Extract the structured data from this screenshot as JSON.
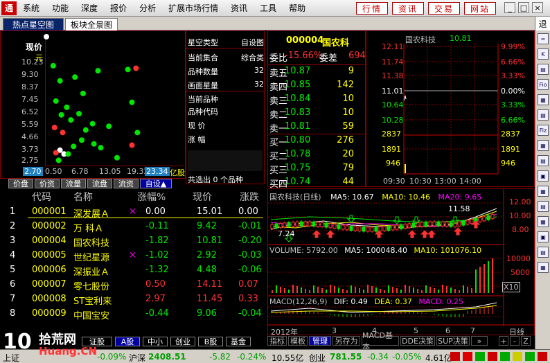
{
  "menu": {
    "logo": "通",
    "items": [
      "系统",
      "功能",
      "深度",
      "报价",
      "分析",
      "扩展市场行情",
      "资讯",
      "工具",
      "帮助"
    ],
    "quick_buttons": [
      "行情",
      "资讯",
      "交易",
      "网站"
    ],
    "win_buttons": [
      "_",
      "□",
      "×"
    ]
  },
  "tabs": [
    "热点星空图",
    "板块全景图"
  ],
  "back_label": "退",
  "right_toolbar": [
    "=",
    "K",
    "▤",
    "Fio",
    "▦",
    "▤",
    "Fiz",
    "▦",
    "▤",
    "▣",
    "▦",
    "▤",
    "▦",
    "▣",
    "▤",
    "▦"
  ],
  "scatter": {
    "y_title": "现价",
    "y_unit": "元",
    "y_labels": [
      "10.23",
      "9.30",
      "8.37",
      "7.45",
      "6.52",
      "5.59",
      "4.66",
      "3.73",
      "2.75"
    ],
    "x_labels": [
      "2.70",
      "0.50",
      "6.78",
      "13.05",
      "19.32",
      "23.34"
    ],
    "x_unit": "亿股",
    "colors": {
      "green": "#00e600",
      "red": "#ff3232",
      "white": "#ffffff"
    },
    "points": [
      {
        "c": "white",
        "x": 0.0,
        "y": 1.0
      },
      {
        "c": "white",
        "x": 0.1,
        "y": 0.1
      },
      {
        "c": "white",
        "x": 0.13,
        "y": 0.07
      },
      {
        "c": "green",
        "x": 0.05,
        "y": 0.77
      },
      {
        "c": "green",
        "x": 0.1,
        "y": 0.65
      },
      {
        "c": "green",
        "x": 0.21,
        "y": 0.68
      },
      {
        "c": "green",
        "x": 0.27,
        "y": 0.55
      },
      {
        "c": "green",
        "x": 0.38,
        "y": 0.73
      },
      {
        "c": "green",
        "x": 0.6,
        "y": 0.74
      },
      {
        "c": "green",
        "x": 0.07,
        "y": 0.49
      },
      {
        "c": "green",
        "x": 0.11,
        "y": 0.38
      },
      {
        "c": "green",
        "x": 0.15,
        "y": 0.44
      },
      {
        "c": "green",
        "x": 0.18,
        "y": 0.34
      },
      {
        "c": "green",
        "x": 0.24,
        "y": 0.39
      },
      {
        "c": "green",
        "x": 0.29,
        "y": 0.26
      },
      {
        "c": "green",
        "x": 0.34,
        "y": 0.31
      },
      {
        "c": "green",
        "x": 0.46,
        "y": 0.29
      },
      {
        "c": "green",
        "x": 0.26,
        "y": 0.18
      },
      {
        "c": "green",
        "x": 0.35,
        "y": 0.15
      },
      {
        "c": "green",
        "x": 0.4,
        "y": 0.12
      },
      {
        "c": "green",
        "x": 0.16,
        "y": 0.07
      },
      {
        "c": "green",
        "x": 0.09,
        "y": 0.02
      },
      {
        "c": "green",
        "x": 0.2,
        "y": 0.13
      },
      {
        "c": "green",
        "x": 0.52,
        "y": 0.04
      },
      {
        "c": "green",
        "x": 0.63,
        "y": 0.48
      },
      {
        "c": "green",
        "x": 0.67,
        "y": 0.24
      },
      {
        "c": "red",
        "x": 0.06,
        "y": 0.28
      },
      {
        "c": "red",
        "x": 0.12,
        "y": 0.24
      },
      {
        "c": "red",
        "x": 0.66,
        "y": 0.75
      },
      {
        "c": "red",
        "x": 0.63,
        "y": 0.14
      },
      {
        "c": "red",
        "x": 0.07,
        "y": 0.08
      }
    ]
  },
  "info": {
    "header_label": "星空类型",
    "header_value": "自设图",
    "rows": [
      {
        "label": "当前集合",
        "value": "综合类"
      },
      {
        "label": "品种数量",
        "value": "32"
      },
      {
        "label": "画面星量",
        "value": "32"
      },
      {
        "label": "当前品种",
        "value": ""
      },
      {
        "label": "品种代码",
        "value": ""
      },
      {
        "label": "现  价",
        "value": ""
      },
      {
        "label": "涨  幅",
        "value": ""
      }
    ],
    "footer": "共选出 0 个品种"
  },
  "sector_tabs": [
    "价盘",
    "价资",
    "流量",
    "流盘",
    "流资",
    "自设▲"
  ],
  "table": {
    "headers": [
      "代码",
      "名称",
      "涨幅%",
      "现价",
      "涨跌"
    ],
    "rows": [
      {
        "n": "1",
        "code": "000001",
        "name": "深发展Ａ",
        "mark": "×",
        "pct": "0.00",
        "price": "15.01",
        "chg": "0.00",
        "dir": "flat"
      },
      {
        "n": "2",
        "code": "000002",
        "name": "万  科Ａ",
        "mark": "",
        "pct": "-0.11",
        "price": "9.42",
        "chg": "-0.01",
        "dir": "down"
      },
      {
        "n": "3",
        "code": "000004",
        "name": "国农科技",
        "mark": "",
        "pct": "-1.82",
        "price": "10.81",
        "chg": "-0.20",
        "dir": "down"
      },
      {
        "n": "4",
        "code": "000005",
        "name": "世纪星源",
        "mark": "×",
        "pct": "-1.02",
        "price": "2.92",
        "chg": "-0.03",
        "dir": "down"
      },
      {
        "n": "5",
        "code": "000006",
        "name": "深振业Ａ",
        "mark": "",
        "pct": "-1.32",
        "price": "4.48",
        "chg": "-0.06",
        "dir": "down"
      },
      {
        "n": "6",
        "code": "000007",
        "name": "零七股份",
        "mark": "",
        "pct": "0.50",
        "price": "14.11",
        "chg": "0.07",
        "dir": "up"
      },
      {
        "n": "7",
        "code": "000008",
        "name": "ST宝利来",
        "mark": "",
        "pct": "2.97",
        "price": "11.45",
        "chg": "0.33",
        "dir": "up"
      },
      {
        "n": "8",
        "code": "000009",
        "name": "中国宝安",
        "mark": "",
        "pct": "-0.44",
        "price": "9.06",
        "chg": "-0.04",
        "dir": "down"
      }
    ]
  },
  "quote": {
    "code": "000004",
    "name": "国农科",
    "wei_bi_label": "委比",
    "wei_bi_value": "-15.66%",
    "wei_cha_label": "委差",
    "wei_cha_value": "694",
    "sells": [
      {
        "label": "卖五",
        "price": "10.87",
        "vol": "9"
      },
      {
        "label": "卖四",
        "price": "10.85",
        "vol": "142"
      },
      {
        "label": "卖三",
        "price": "10.84",
        "vol": "10"
      },
      {
        "label": "卖二",
        "price": "10.83",
        "vol": "10"
      },
      {
        "label": "卖一",
        "price": "10.81",
        "vol": "59"
      }
    ],
    "buys": [
      {
        "label": "买一",
        "price": "10.80",
        "vol": "276"
      },
      {
        "label": "买二",
        "price": "10.78",
        "vol": "20"
      },
      {
        "label": "买三",
        "price": "10.75",
        "vol": "79"
      },
      {
        "label": "买四",
        "price": "10.74",
        "vol": "44"
      }
    ]
  },
  "intraday": {
    "title": "国农科技",
    "price": "10.81",
    "left_labels": [
      "12.11",
      "11.74",
      "11.38",
      "11.01",
      "10.64",
      "10.28",
      "2837",
      "1891",
      "946"
    ],
    "right_labels": [
      "9.99%",
      "6.66%",
      "3.33%",
      "0.00%",
      "3.33%",
      "6.66%",
      "2837",
      "1891",
      "946"
    ],
    "time_labels": [
      "09:30",
      "10:30",
      "13:00",
      "14:00"
    ]
  },
  "kline": {
    "title": "国农科技(日线)",
    "ma5": "MA5: 10.67",
    "ma10": "MA10: 10.46",
    "ma20": "MA20: 9.65",
    "price_labels": [
      "12.00",
      "10.00",
      "8.00"
    ],
    "high_mark": "11.58",
    "low_mark": "7.24",
    "volume_text": "VOLUME: 5792.00",
    "vol_ma5": "MA5: 100048.40",
    "vol_ma10": "MA10: 101076.10",
    "vol_labels": [
      "10000",
      "5000"
    ],
    "vol_unit": "X10",
    "macd_text": "MACD(12,26,9)",
    "dif": "DIF: 0.49",
    "dea": "DEA: 0.37",
    "macd": "MACD: 0.25",
    "date_labels": [
      "2012年",
      "3",
      "4",
      "5",
      "6",
      "7"
    ],
    "period": "日线"
  },
  "bottom_tabs": [
    "指标",
    "模板",
    "管理",
    "另存为",
    "MACD基本",
    "DDE决策",
    "SUP决策",
    "»",
    "+",
    "-",
    "Z"
  ],
  "market_tabs": [
    "证股",
    "A股",
    "中小",
    "创业",
    "B股",
    "基金"
  ],
  "status": {
    "sh_label": "上证",
    "sh_pct": "-0.09%",
    "hs_label": "沪深",
    "hs_value": "2408.51",
    "hs_chg": "-5.82",
    "hs_pct": "-0.24%",
    "hs_amount": "10.55亿",
    "cy_label": "创业",
    "cy_value": "781.55",
    "cy_chg": "-0.34",
    "cy_pct": "-0.05%",
    "cy_amount": "4.61亿"
  },
  "watermark": {
    "number": "10",
    "brand": "拾荒网",
    "url": "Huang.CN"
  }
}
